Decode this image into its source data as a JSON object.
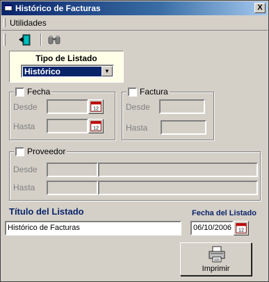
{
  "window": {
    "title": "Histórico de Facturas",
    "close_label": "X"
  },
  "menu": {
    "items": [
      {
        "label": "Utilidades"
      }
    ]
  },
  "tipo_listado": {
    "label": "Tipo de Listado",
    "selected": "Histórico"
  },
  "fecha_group": {
    "label": "Fecha",
    "checked": false,
    "desde_label": "Desde",
    "hasta_label": "Hasta"
  },
  "factura_group": {
    "label": "Factura",
    "checked": false,
    "desde_label": "Desde",
    "hasta_label": "Hasta"
  },
  "proveedor_group": {
    "label": "Proveedor",
    "checked": false,
    "desde_label": "Desde",
    "hasta_label": "Hasta"
  },
  "titulo_listado": {
    "label": "Título del Listado",
    "value": "Histórico de Facturas"
  },
  "fecha_listado": {
    "label": "Fecha del Listado",
    "value": "06/10/2006"
  },
  "print_button": {
    "label": "Imprimir"
  },
  "colors": {
    "titlebar": "#0a246a",
    "window_bg": "#d4d0c8",
    "tipo_bg": "#ffffe8",
    "label_blue": "#0a246a"
  }
}
